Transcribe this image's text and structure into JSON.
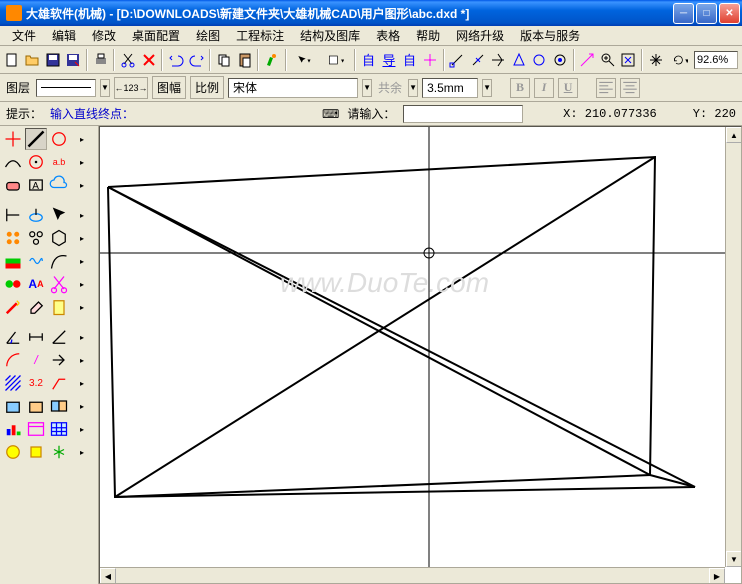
{
  "window": {
    "title": "大雄软件(机械) - [D:\\DOWNLOADS\\新建文件夹\\大雄机械CAD\\用户图形\\abc.dxd *]"
  },
  "menu": {
    "items": [
      "文件",
      "编辑",
      "修改",
      "桌面配置",
      "绘图",
      "工程标注",
      "结构及图库",
      "表格",
      "帮助",
      "网络升级",
      "版本与服务"
    ]
  },
  "toolbar2": {
    "layer_label": "图层",
    "dim_label": "123",
    "frame_label": "图幅",
    "scale_label": "比例",
    "font": "宋体",
    "allow_label": "共余",
    "size": "3.5mm"
  },
  "prompt": {
    "hint_label": "提示：",
    "hint_text": "输入直线终点：",
    "input_label": "请输入：",
    "x_label": "X:",
    "x_value": "210.077336",
    "y_label": "Y:",
    "y_value": "220"
  },
  "zoom": "92.6%",
  "watermark": "www.DuoTe.com",
  "icons": {
    "minimize": "─",
    "maximize": "□",
    "close": "✕"
  }
}
